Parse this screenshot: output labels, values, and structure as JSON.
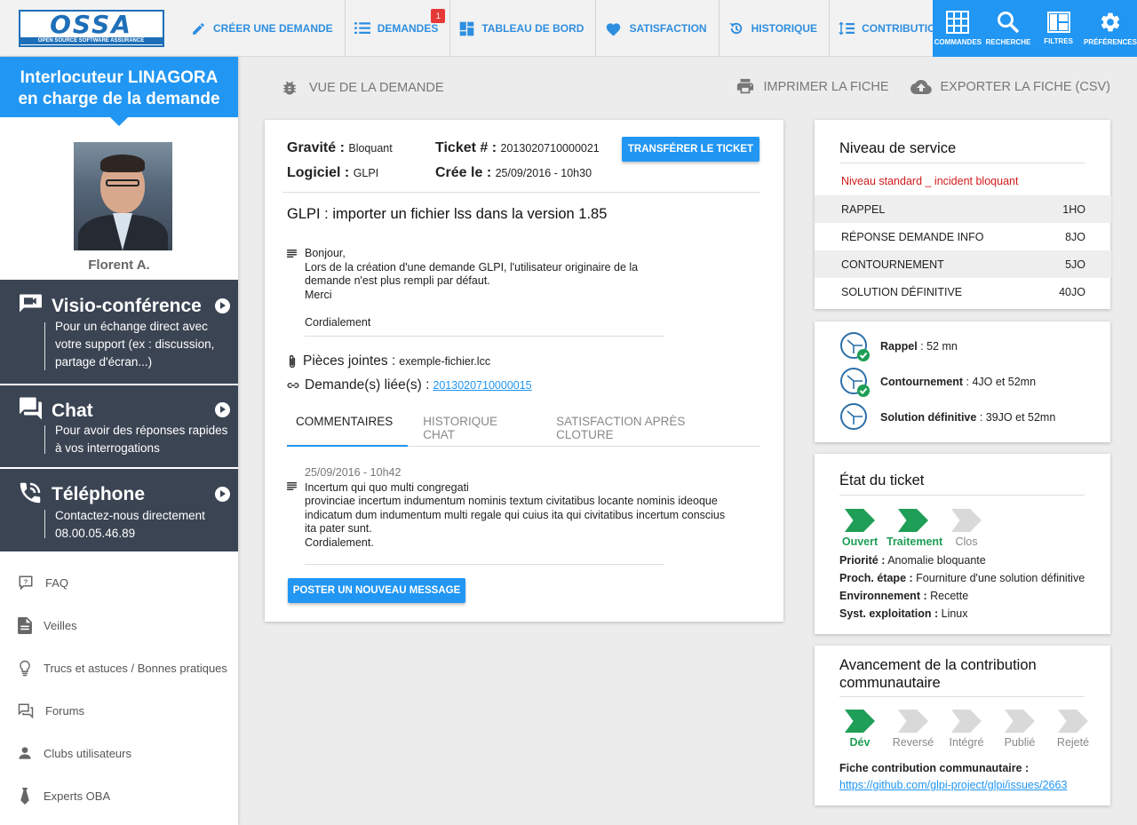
{
  "brand": {
    "logo_text": "OSSA",
    "logo_sub": "OPEN SOURCE SOFTWARE ASSURANCE",
    "accent": "#2196f3",
    "dark": "#3b4453",
    "green": "#1e9e56",
    "red": "#d01a1a"
  },
  "nav": {
    "items": [
      {
        "label": "Créer une demande",
        "icon": "pencil-icon"
      },
      {
        "label": "Demandes",
        "icon": "list-icon",
        "badge": "1"
      },
      {
        "label": "Tableau de bord",
        "icon": "dashboard-icon"
      },
      {
        "label": "Satisfaction",
        "icon": "heart-icon"
      },
      {
        "label": "Historique",
        "icon": "history-icon"
      },
      {
        "label": "Contributions",
        "icon": "contributions-icon"
      }
    ],
    "tools": [
      {
        "label": "Commandes",
        "icon": "grid-icon"
      },
      {
        "label": "Recherche",
        "icon": "search-icon"
      },
      {
        "label": "Filtres",
        "icon": "filters-icon"
      },
      {
        "label": "Préférences",
        "icon": "gear-icon"
      }
    ]
  },
  "sidebar": {
    "header_line1": "Interlocuteur LINAGORA",
    "header_line2": "en charge de la demande",
    "person_name": "Florent A.",
    "channels": [
      {
        "title": "Visio-conférence",
        "desc": "Pour un échange direct avec votre support (ex : discussion, partage d'écran...)",
        "icon": "video-chat-icon"
      },
      {
        "title": "Chat",
        "desc": "Pour avoir des réponses rapides à vos interrogations",
        "icon": "chat-icon"
      },
      {
        "title": "Téléphone",
        "desc": "Contactez-nous directement",
        "phone": "08.00.05.46.89",
        "icon": "phone-icon"
      }
    ],
    "links": [
      {
        "label": "FAQ",
        "icon": "faq-icon"
      },
      {
        "label": "Veilles",
        "icon": "document-icon"
      },
      {
        "label": "Trucs et astuces / Bonnes pratiques",
        "icon": "lightbulb-icon"
      },
      {
        "label": "Forums",
        "icon": "forum-icon"
      },
      {
        "label": "Clubs utilisateurs",
        "icon": "person-icon"
      },
      {
        "label": "Experts OBA",
        "icon": "tie-icon"
      }
    ]
  },
  "page": {
    "title": "Vue de la demande",
    "print_label": "Imprimer la fiche",
    "export_label": "Exporter la fiche (CSV)"
  },
  "ticket": {
    "gravite_label": "Gravité",
    "gravite_value": "Bloquant",
    "logiciel_label": "Logiciel :",
    "logiciel_value": "GLPI",
    "ticket_label": "Ticket #",
    "ticket_value": "2013020710000021",
    "cree_label": "Crée le :",
    "cree_value": "25/09/2016 - 10h30",
    "transfer_label": "Transférer le ticket",
    "subject": "GLPI : importer un fichier lss dans la version 1.85",
    "body": [
      "Bonjour,",
      "Lors de la création d'une demande GLPI, l'utilisateur originaire de la",
      "demande n'est plus rempli par défaut.",
      "Merci",
      "",
      "Cordialement"
    ],
    "attachments_label": "Pièces jointes :",
    "attachment": "exemple-fichier.lcc",
    "related_label": "Demande(s) liée(s) :",
    "related": "2013020710000015",
    "tabs": [
      "Commentaires",
      "Historique chat",
      "Satisfaction après cloture"
    ],
    "comment": {
      "date": "25/09/2016 - 10h42",
      "lines": [
        "Incertum qui quo multi congregati",
        "provinciae incertum indumentum nominis textum civitatibus locante nominis ideoque",
        "indicatum dum indumentum multi regale qui cuius ita qui civitatibus incertum conscius",
        "ita pater sunt.",
        "Cordialement."
      ]
    },
    "post_label": "Poster un nouveau message"
  },
  "service": {
    "title": "Niveau de service",
    "level": "Niveau standard _ incident bloquant",
    "rows": [
      {
        "label": "Rappel",
        "value": "1HO"
      },
      {
        "label": "Réponse demande info",
        "value": "8JO"
      },
      {
        "label": "Contournement",
        "value": "5JO"
      },
      {
        "label": "Solution définitive",
        "value": "40JO"
      }
    ]
  },
  "timers": [
    {
      "label": "Rappel",
      "value": "52 mn",
      "done": true
    },
    {
      "label": "Contournement",
      "value": "4JO et 52mn",
      "done": true
    },
    {
      "label": "Solution définitive",
      "value": "39JO et 52mn",
      "done": false
    }
  ],
  "state": {
    "title": "État du ticket",
    "steps": [
      {
        "label": "Ouvert",
        "active": true
      },
      {
        "label": "Traitement",
        "active": true
      },
      {
        "label": "Clos",
        "active": false
      }
    ],
    "priorite_label": "Priorité :",
    "priorite": "Anomalie bloquante",
    "etape_label": "Proch. étape :",
    "etape": "Fourniture d'une solution définitive",
    "env_label": "Environnement :",
    "env": "Recette",
    "os_label": "Syst. exploitation :",
    "os": "Linux"
  },
  "contribution": {
    "title_line1": "Avancement de la contribution",
    "title_line2": "communautaire",
    "steps": [
      {
        "label": "Dév",
        "active": true
      },
      {
        "label": "Reversé",
        "active": false
      },
      {
        "label": "Intégré",
        "active": false
      },
      {
        "label": "Publié",
        "active": false
      },
      {
        "label": "Rejeté",
        "active": false
      }
    ],
    "fiche_label": "Fiche contribution communautaire :",
    "fiche_url": "https://github.com/glpi-project/glpi/issues/2663"
  }
}
